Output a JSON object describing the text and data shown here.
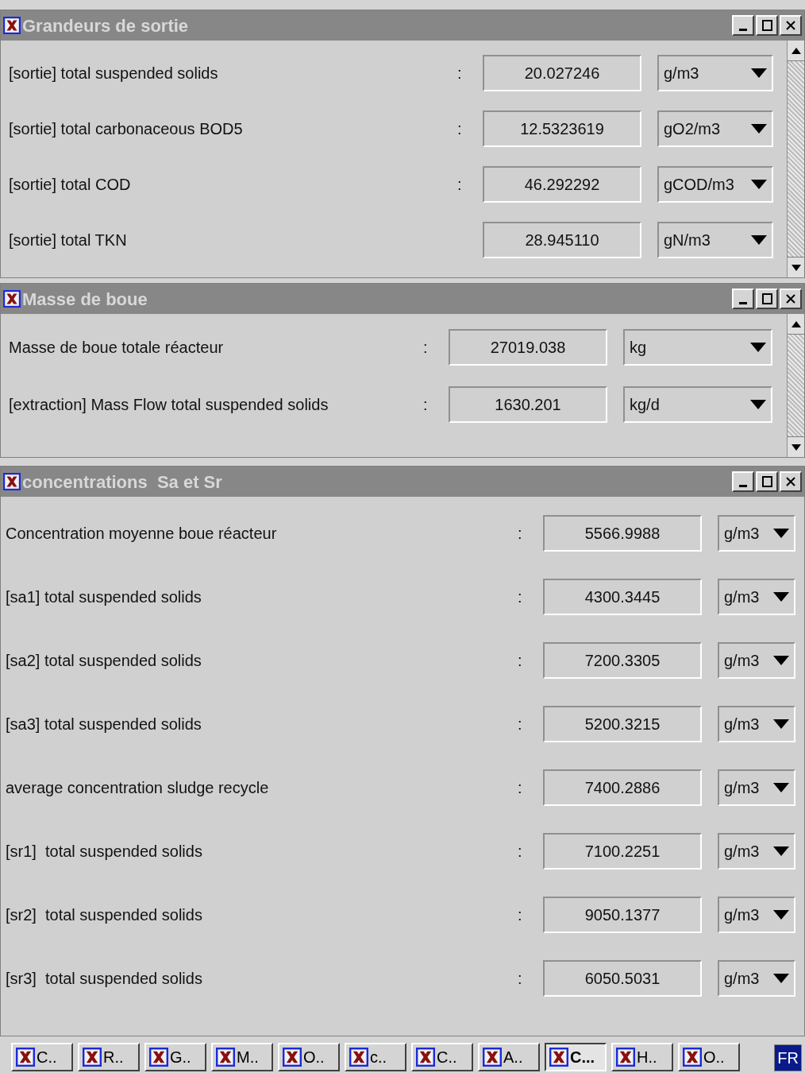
{
  "windows": [
    {
      "title": "Grandeurs de sortie",
      "scrollbar": true,
      "rows": [
        {
          "label": "[sortie] total suspended solids",
          "separator": ":",
          "value": "20.027246",
          "unit": "g/m3"
        },
        {
          "label": "[sortie] total carbonaceous BOD5",
          "separator": ":",
          "value": "12.5323619",
          "unit": "gO2/m3"
        },
        {
          "label": "[sortie] total COD",
          "separator": ":",
          "value": "46.292292",
          "unit": "gCOD/m3"
        },
        {
          "label": "[sortie] total TKN",
          "value": "28.945110",
          "unit": "gN/m3"
        }
      ]
    },
    {
      "title": "Masse de boue",
      "scrollbar": true,
      "rows": [
        {
          "label": "Masse de boue totale réacteur",
          "separator": ":",
          "value": "27019.038",
          "unit": "kg"
        },
        {
          "label": "[extraction] Mass Flow total suspended solids",
          "separator": ":",
          "value": "1630.201",
          "unit": "kg/d"
        }
      ]
    },
    {
      "title": "concentrations  Sa et Sr",
      "scrollbar": false,
      "rows": [
        {
          "label": "Concentration moyenne boue réacteur",
          "separator": ":",
          "value": "5566.9988",
          "unit": "g/m3"
        },
        {
          "label": "[sa1] total suspended solids",
          "separator": ":",
          "value": "4300.3445",
          "unit": "g/m3"
        },
        {
          "label": "[sa2] total suspended solids",
          "separator": ":",
          "value": "7200.3305",
          "unit": "g/m3"
        },
        {
          "label": "[sa3] total suspended solids",
          "separator": ":",
          "value": "5200.3215",
          "unit": "g/m3"
        },
        {
          "label": "average concentration sludge recycle",
          "separator": ":",
          "value": "7400.2886",
          "unit": "g/m3"
        },
        {
          "label": "[sr1]  total suspended solids",
          "separator": ":",
          "value": "7100.2251",
          "unit": "g/m3"
        },
        {
          "label": "[sr2]  total suspended solids",
          "separator": ":",
          "value": "9050.1377",
          "unit": "g/m3"
        },
        {
          "label": "[sr3]  total suspended solids",
          "separator": ":",
          "value": "6050.5031",
          "unit": "g/m3"
        }
      ]
    }
  ],
  "taskbar": {
    "items": [
      {
        "label": "C..",
        "selected": false
      },
      {
        "label": "R..",
        "selected": false
      },
      {
        "label": "G..",
        "selected": false
      },
      {
        "label": "M..",
        "selected": false
      },
      {
        "label": "O..",
        "selected": false
      },
      {
        "label": "c..",
        "selected": false
      },
      {
        "label": "C..",
        "selected": false
      },
      {
        "label": "A..",
        "selected": false
      },
      {
        "label": "C...",
        "selected": true
      },
      {
        "label": "H..",
        "selected": false
      },
      {
        "label": "O..",
        "selected": false
      }
    ],
    "language": "FR"
  }
}
